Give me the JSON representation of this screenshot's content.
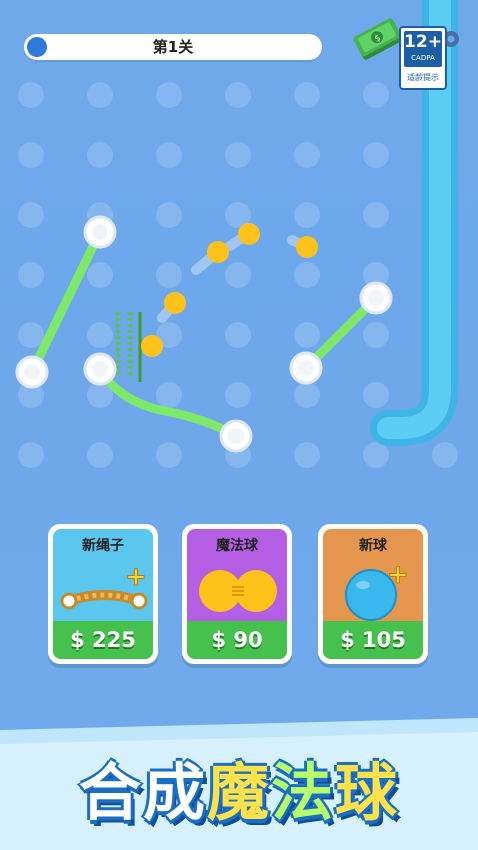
{
  "level": {
    "label": "第1关",
    "progress_percent": 4
  },
  "age_rating": {
    "value": "12+",
    "org": "CADPA",
    "tip": "适龄提示"
  },
  "icons": {
    "cash": "cash-stack-icon",
    "settings": "gear-icon",
    "add": "plus-icon"
  },
  "colors": {
    "rope": "#7ee86a",
    "ball": "#ffc21a",
    "pipe": "#4cc3ee",
    "price_green": "#46c14e"
  },
  "shop": [
    {
      "title": "新绳子",
      "price": "$ 225",
      "bg": "#5bc7ef",
      "icon": "rope-icon"
    },
    {
      "title": "魔法球",
      "price": "$ 90",
      "bg": "#b35ee3",
      "icon": "merge-balls-icon"
    },
    {
      "title": "新球",
      "price": "$ 105",
      "bg": "#e4964f",
      "icon": "new-ball-icon"
    }
  ],
  "banner": {
    "chars": [
      "合",
      "成",
      "魔",
      "法",
      "球"
    ]
  }
}
